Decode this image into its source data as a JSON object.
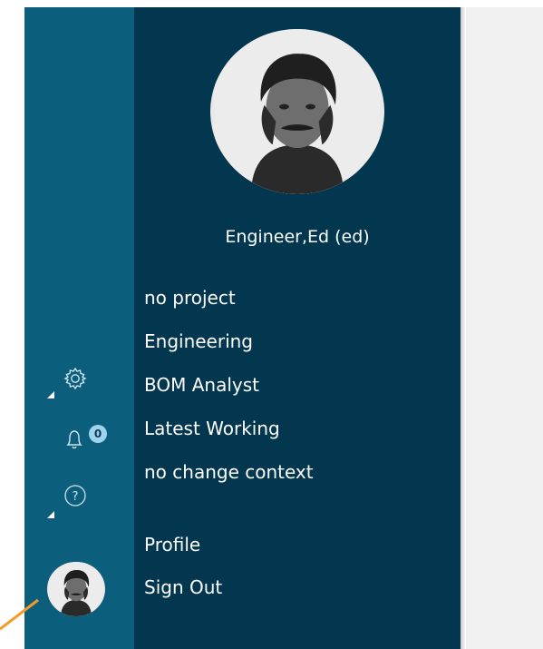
{
  "user": {
    "display_name": "Engineer,Ed (ed)",
    "avatar_icon": "portrait-avatar"
  },
  "context_items": [
    {
      "label": "no project"
    },
    {
      "label": "Engineering"
    },
    {
      "label": "BOM Analyst"
    },
    {
      "label": "Latest Working"
    },
    {
      "label": "no change context"
    }
  ],
  "actions": [
    {
      "label": "Profile"
    },
    {
      "label": "Sign Out"
    }
  ],
  "rail": {
    "settings_icon": "gear-icon",
    "notifications_icon": "bell-icon",
    "notifications_count": "0",
    "help_icon": "help-icon"
  },
  "colors": {
    "rail_bg": "#0b5f7d",
    "panel_bg": "#03364f",
    "badge_bg": "#9fd3ec",
    "annotation_arrow": "#f39a2b"
  }
}
